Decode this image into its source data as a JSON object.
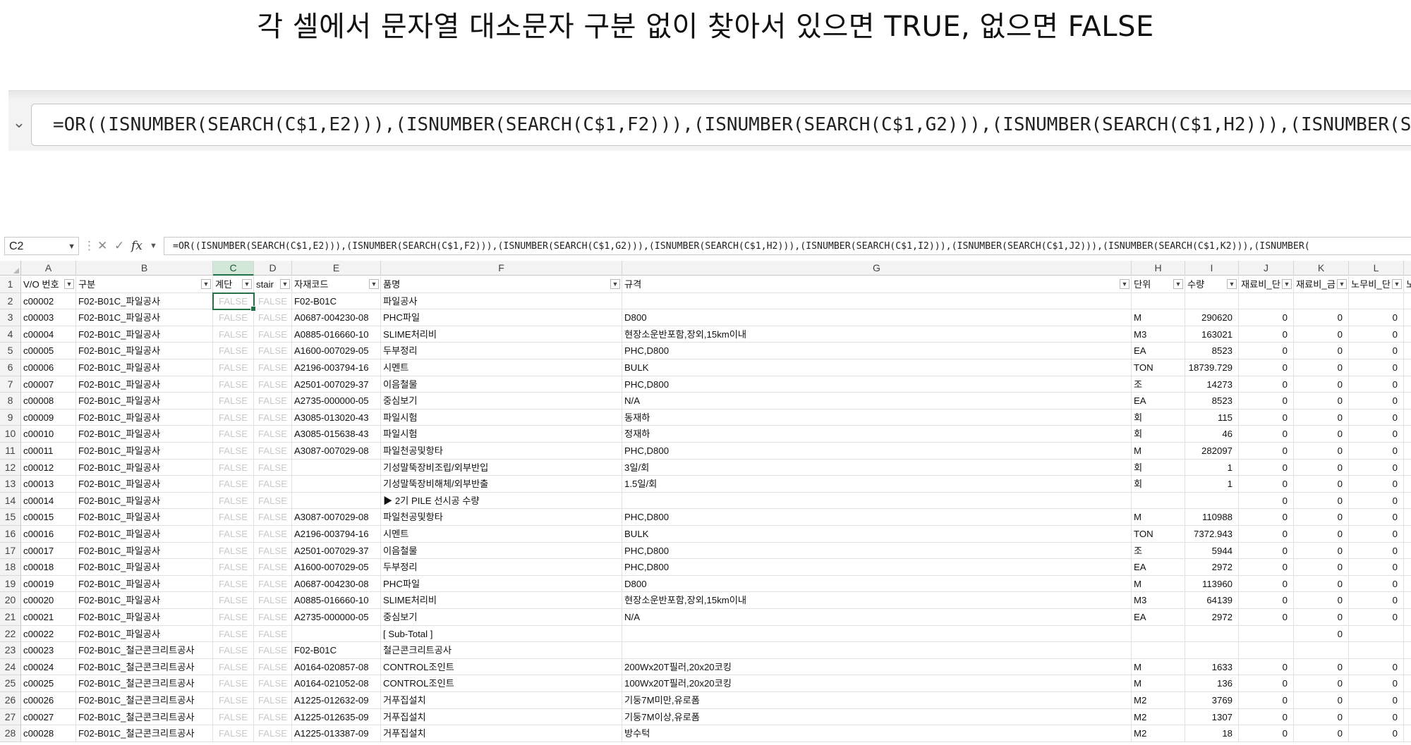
{
  "title": "각 셀에서 문자열 대소문자 구분 없이 찾아서 있으면 TRUE, 없으면 FALSE",
  "zoomed_formula": "=OR((ISNUMBER(SEARCH(C$1,E2))),(ISNUMBER(SEARCH(C$1,F2))),(ISNUMBER(SEARCH(C$1,G2))),(ISNUMBER(SEARCH(C$1,H2))),(ISNUMBER(SEARCH(C$1,I2))),(ISNUMBER(SEARCH(C$1,J2)))",
  "name_box": "C2",
  "fx_label": "fx",
  "formula_bar": "=OR((ISNUMBER(SEARCH(C$1,E2))),(ISNUMBER(SEARCH(C$1,F2))),(ISNUMBER(SEARCH(C$1,G2))),(ISNUMBER(SEARCH(C$1,H2))),(ISNUMBER(SEARCH(C$1,I2))),(ISNUMBER(SEARCH(C$1,J2))),(ISNUMBER(SEARCH(C$1,K2))),(ISNUMBER(",
  "columns": [
    "A",
    "B",
    "C",
    "D",
    "E",
    "F",
    "G",
    "H",
    "I",
    "J",
    "K",
    "L"
  ],
  "selected_column": "C",
  "headers": [
    "V/O 번호",
    "구분",
    "계단",
    "stair",
    "자재코드",
    "품명",
    "규격",
    "단위",
    "수량",
    "재료비_단",
    "재료비_금",
    "노무비_단",
    "노"
  ],
  "rows": [
    {
      "n": "2",
      "a": "c00002",
      "b": "F02-B01C_파일공사",
      "c": "FALSE",
      "d": "FALSE",
      "e": "F02-B01C",
      "f": "파일공사",
      "g": "",
      "h": "",
      "i": "",
      "j": "",
      "k": "",
      "l": ""
    },
    {
      "n": "3",
      "a": "c00003",
      "b": "F02-B01C_파일공사",
      "c": "FALSE",
      "d": "FALSE",
      "e": "A0687-004230-08",
      "f": "PHC파일",
      "g": "D800",
      "h": "M",
      "i": "290620",
      "j": "0",
      "k": "0",
      "l": "0"
    },
    {
      "n": "4",
      "a": "c00004",
      "b": "F02-B01C_파일공사",
      "c": "FALSE",
      "d": "FALSE",
      "e": "A0885-016660-10",
      "f": "SLIME처리비",
      "g": "현장소운반포함,장외,15km이내",
      "h": "M3",
      "i": "163021",
      "j": "0",
      "k": "0",
      "l": "0"
    },
    {
      "n": "5",
      "a": "c00005",
      "b": "F02-B01C_파일공사",
      "c": "FALSE",
      "d": "FALSE",
      "e": "A1600-007029-05",
      "f": "두부정리",
      "g": "PHC,D800",
      "h": "EA",
      "i": "8523",
      "j": "0",
      "k": "0",
      "l": "0"
    },
    {
      "n": "6",
      "a": "c00006",
      "b": "F02-B01C_파일공사",
      "c": "FALSE",
      "d": "FALSE",
      "e": "A2196-003794-16",
      "f": "시멘트",
      "g": "BULK",
      "h": "TON",
      "i": "18739.729",
      "j": "0",
      "k": "0",
      "l": "0"
    },
    {
      "n": "7",
      "a": "c00007",
      "b": "F02-B01C_파일공사",
      "c": "FALSE",
      "d": "FALSE",
      "e": "A2501-007029-37",
      "f": "이음철물",
      "g": "PHC,D800",
      "h": "조",
      "i": "14273",
      "j": "0",
      "k": "0",
      "l": "0"
    },
    {
      "n": "8",
      "a": "c00008",
      "b": "F02-B01C_파일공사",
      "c": "FALSE",
      "d": "FALSE",
      "e": "A2735-000000-05",
      "f": "중심보기",
      "g": "N/A",
      "h": "EA",
      "i": "8523",
      "j": "0",
      "k": "0",
      "l": "0"
    },
    {
      "n": "9",
      "a": "c00009",
      "b": "F02-B01C_파일공사",
      "c": "FALSE",
      "d": "FALSE",
      "e": "A3085-013020-43",
      "f": "파일시험",
      "g": "동재하",
      "h": "회",
      "i": "115",
      "j": "0",
      "k": "0",
      "l": "0"
    },
    {
      "n": "10",
      "a": "c00010",
      "b": "F02-B01C_파일공사",
      "c": "FALSE",
      "d": "FALSE",
      "e": "A3085-015638-43",
      "f": "파일시험",
      "g": "정재하",
      "h": "회",
      "i": "46",
      "j": "0",
      "k": "0",
      "l": "0"
    },
    {
      "n": "11",
      "a": "c00011",
      "b": "F02-B01C_파일공사",
      "c": "FALSE",
      "d": "FALSE",
      "e": "A3087-007029-08",
      "f": "파일천공및항타",
      "g": "PHC,D800",
      "h": "M",
      "i": "282097",
      "j": "0",
      "k": "0",
      "l": "0"
    },
    {
      "n": "12",
      "a": "c00012",
      "b": "F02-B01C_파일공사",
      "c": "FALSE",
      "d": "FALSE",
      "e": "",
      "f": "기성말뚝장비조립/외부반입",
      "g": "3일/회",
      "h": "회",
      "i": "1",
      "j": "0",
      "k": "0",
      "l": "0"
    },
    {
      "n": "13",
      "a": "c00013",
      "b": "F02-B01C_파일공사",
      "c": "FALSE",
      "d": "FALSE",
      "e": "",
      "f": "기성말뚝장비해체/외부반출",
      "g": "1.5일/회",
      "h": "회",
      "i": "1",
      "j": "0",
      "k": "0",
      "l": "0"
    },
    {
      "n": "14",
      "a": "c00014",
      "b": "F02-B01C_파일공사",
      "c": "FALSE",
      "d": "FALSE",
      "e": "",
      "f": "▶ 2기 PILE 선시공 수량",
      "g": "",
      "h": "",
      "i": "",
      "j": "0",
      "k": "0",
      "l": "0"
    },
    {
      "n": "15",
      "a": "c00015",
      "b": "F02-B01C_파일공사",
      "c": "FALSE",
      "d": "FALSE",
      "e": "A3087-007029-08",
      "f": "파일천공및항타",
      "g": "PHC,D800",
      "h": "M",
      "i": "110988",
      "j": "0",
      "k": "0",
      "l": "0"
    },
    {
      "n": "16",
      "a": "c00016",
      "b": "F02-B01C_파일공사",
      "c": "FALSE",
      "d": "FALSE",
      "e": "A2196-003794-16",
      "f": "시멘트",
      "g": "BULK",
      "h": "TON",
      "i": "7372.943",
      "j": "0",
      "k": "0",
      "l": "0"
    },
    {
      "n": "17",
      "a": "c00017",
      "b": "F02-B01C_파일공사",
      "c": "FALSE",
      "d": "FALSE",
      "e": "A2501-007029-37",
      "f": "이음철물",
      "g": "PHC,D800",
      "h": "조",
      "i": "5944",
      "j": "0",
      "k": "0",
      "l": "0"
    },
    {
      "n": "18",
      "a": "c00018",
      "b": "F02-B01C_파일공사",
      "c": "FALSE",
      "d": "FALSE",
      "e": "A1600-007029-05",
      "f": "두부정리",
      "g": "PHC,D800",
      "h": "EA",
      "i": "2972",
      "j": "0",
      "k": "0",
      "l": "0"
    },
    {
      "n": "19",
      "a": "c00019",
      "b": "F02-B01C_파일공사",
      "c": "FALSE",
      "d": "FALSE",
      "e": "A0687-004230-08",
      "f": "PHC파일",
      "g": "D800",
      "h": "M",
      "i": "113960",
      "j": "0",
      "k": "0",
      "l": "0"
    },
    {
      "n": "20",
      "a": "c00020",
      "b": "F02-B01C_파일공사",
      "c": "FALSE",
      "d": "FALSE",
      "e": "A0885-016660-10",
      "f": "SLIME처리비",
      "g": "현장소운반포함,장외,15km이내",
      "h": "M3",
      "i": "64139",
      "j": "0",
      "k": "0",
      "l": "0"
    },
    {
      "n": "21",
      "a": "c00021",
      "b": "F02-B01C_파일공사",
      "c": "FALSE",
      "d": "FALSE",
      "e": "A2735-000000-05",
      "f": "중심보기",
      "g": "N/A",
      "h": "EA",
      "i": "2972",
      "j": "0",
      "k": "0",
      "l": "0"
    },
    {
      "n": "22",
      "a": "c00022",
      "b": "F02-B01C_파일공사",
      "c": "FALSE",
      "d": "FALSE",
      "e": "",
      "f": "[ Sub-Total ]",
      "g": "",
      "h": "",
      "i": "",
      "j": "",
      "k": "0",
      "l": ""
    },
    {
      "n": "23",
      "a": "c00023",
      "b": "F02-B01C_철근콘크리트공사",
      "c": "FALSE",
      "d": "FALSE",
      "e": "F02-B01C",
      "f": "철근콘크리트공사",
      "g": "",
      "h": "",
      "i": "",
      "j": "",
      "k": "",
      "l": ""
    },
    {
      "n": "24",
      "a": "c00024",
      "b": "F02-B01C_철근콘크리트공사",
      "c": "FALSE",
      "d": "FALSE",
      "e": "A0164-020857-08",
      "f": "CONTROL조인트",
      "g": "200Wx20T필러,20x20코킹",
      "h": "M",
      "i": "1633",
      "j": "0",
      "k": "0",
      "l": "0"
    },
    {
      "n": "25",
      "a": "c00025",
      "b": "F02-B01C_철근콘크리트공사",
      "c": "FALSE",
      "d": "FALSE",
      "e": "A0164-021052-08",
      "f": "CONTROL조인트",
      "g": "100Wx20T필러,20x20코킹",
      "h": "M",
      "i": "136",
      "j": "0",
      "k": "0",
      "l": "0"
    },
    {
      "n": "26",
      "a": "c00026",
      "b": "F02-B01C_철근콘크리트공사",
      "c": "FALSE",
      "d": "FALSE",
      "e": "A1225-012632-09",
      "f": "거푸집설치",
      "g": "기둥7M미만,유로폼",
      "h": "M2",
      "i": "3769",
      "j": "0",
      "k": "0",
      "l": "0"
    },
    {
      "n": "27",
      "a": "c00027",
      "b": "F02-B01C_철근콘크리트공사",
      "c": "FALSE",
      "d": "FALSE",
      "e": "A1225-012635-09",
      "f": "거푸집설치",
      "g": "기둥7M이상,유로폼",
      "h": "M2",
      "i": "1307",
      "j": "0",
      "k": "0",
      "l": "0"
    },
    {
      "n": "28",
      "a": "c00028",
      "b": "F02-B01C_철근콘크리트공사",
      "c": "FALSE",
      "d": "FALSE",
      "e": "A1225-013387-09",
      "f": "거푸집설치",
      "g": "방수턱",
      "h": "M2",
      "i": "18",
      "j": "0",
      "k": "0",
      "l": "0"
    }
  ]
}
